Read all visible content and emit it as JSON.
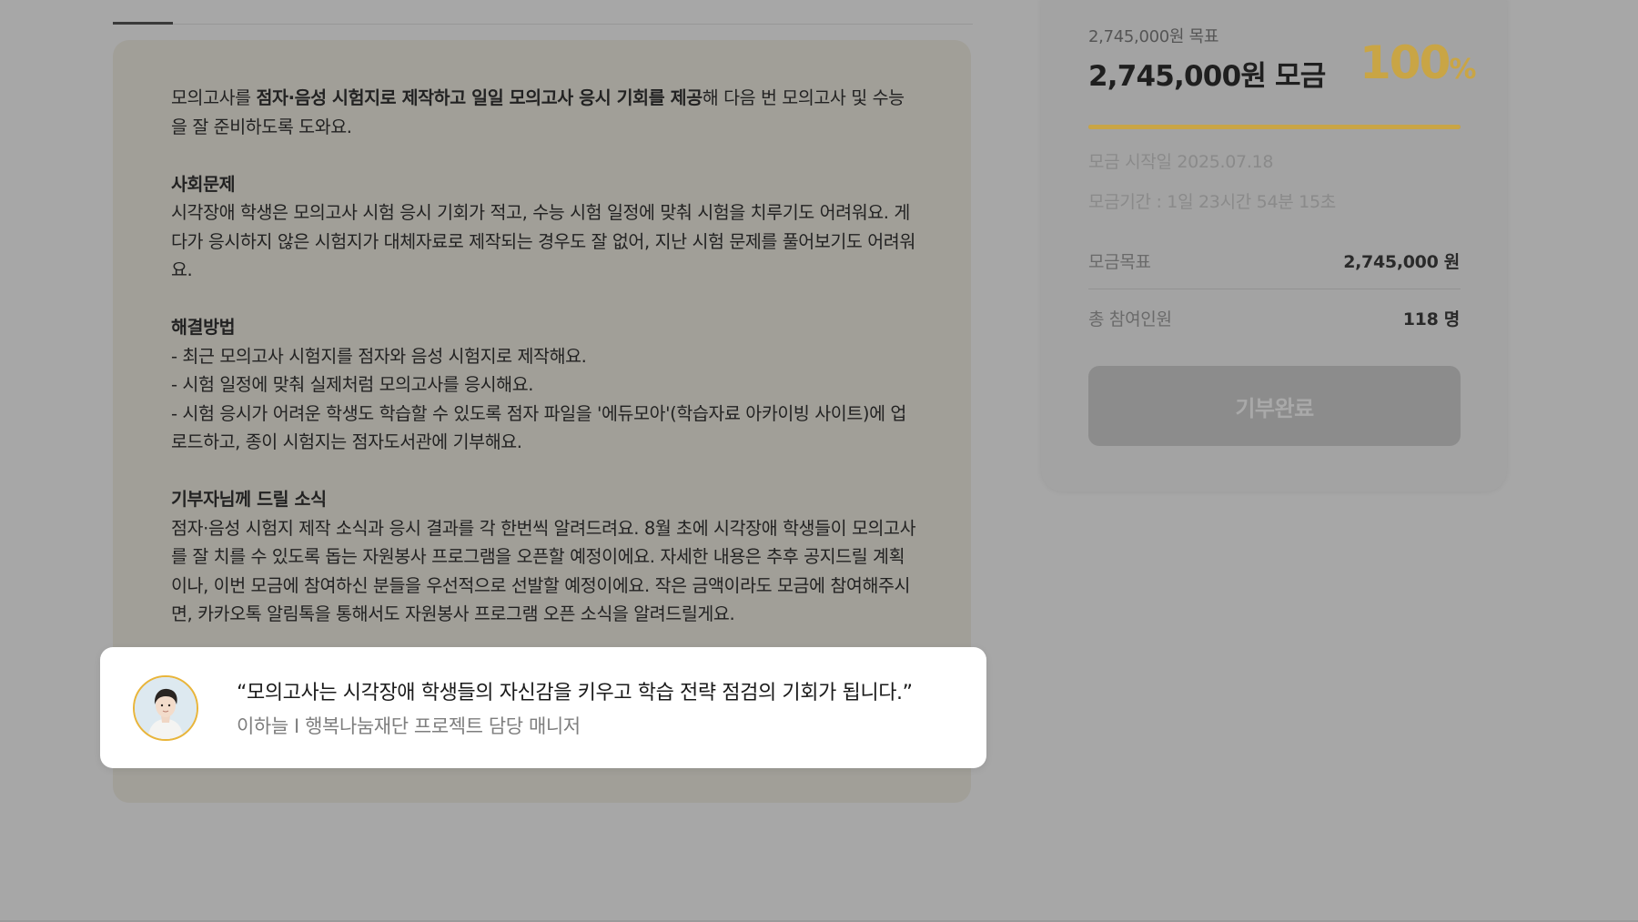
{
  "story": {
    "intro_prefix": "모의고사를 ",
    "intro_bold": "점자·음성 시험지로 제작하고 일일 모의고사 응시 기회를 제공",
    "intro_suffix": "해 다음 번 모의고사 및 수능을 잘 준비하도록 도와요.",
    "sections": [
      {
        "title": "사회문제",
        "body": "시각장애 학생은 모의고사 시험 응시 기회가 적고, 수능 시험 일정에 맞춰 시험을 치루기도 어려워요. 게다가 응시하지 않은 시험지가 대체자료로 제작되는 경우도 잘 없어, 지난 시험 문제를 풀어보기도 어려워요."
      },
      {
        "title": "해결방법",
        "lines": [
          "- 최근 모의고사 시험지를 점자와 음성 시험지로 제작해요.",
          "- 시험 일정에 맞춰 실제처럼 모의고사를 응시해요.",
          "- 시험 응시가 어려운 학생도 학습할 수 있도록 점자 파일을 '에듀모아'(학습자료 아카이빙 사이트)에 업로드하고, 종이 시험지는 점자도서관에 기부해요."
        ]
      },
      {
        "title": "기부자님께 드릴 소식",
        "body": "점자·음성 시험지 제작 소식과 응시 결과를 각 한번씩 알려드려요. 8월 초에 시각장애 학생들이 모의고사를 잘 치를 수 있도록 돕는 자원봉사 프로그램을 오픈할 예정이에요. 자세한 내용은 추후 공지드릴 계획이나, 이번 모금에 참여하신 분들을 우선적으로 선발할 예정이에요. 작은 금액이라도 모금에 참여해주시면, 카카오톡 알림톡을 통해서도 자원봉사 프로그램 오픈 소식을 알려드릴게요."
      }
    ]
  },
  "quote": {
    "text": "“모의고사는 시각장애 학생들의 자신감을 키우고 학습 전략 점검의 기회가 됩니다.”",
    "author": "이하늘 I 행복나눔재단 프로젝트 담당 매니저"
  },
  "funding": {
    "goal_small": "2,745,000원 목표",
    "raised": "2,745,000원 모금",
    "percent_num": "100",
    "percent_sign": "%",
    "progress": 1.0,
    "start_date": "모금 시작일 2025.07.18",
    "period": "모금기간 : 1일 23시간 54분 15초",
    "goal_label": "모금목표",
    "goal_value": "2,745,000 원",
    "participants_label": "총 참여인원",
    "participants_value": "118 명",
    "button_label": "기부완료"
  },
  "colors": {
    "accent": "#c9a545",
    "overlay_bg": "#a7a7a7"
  }
}
